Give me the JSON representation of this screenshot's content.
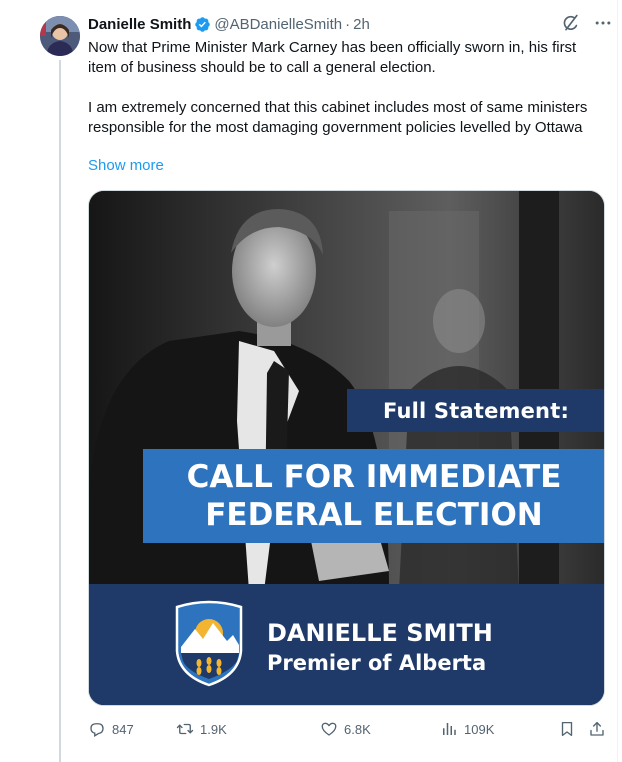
{
  "tweet": {
    "display_name": "Danielle Smith",
    "handle": "@ABDanielleSmith",
    "separator": "·",
    "time": "2h",
    "text_para1": "Now that Prime Minister Mark Carney has been officially sworn in, his first item of business should be to call a general election.",
    "text_para2": "I am extremely concerned that this cabinet includes most of same ministers responsible for the most damaging government policies levelled by Ottawa",
    "show_more": "Show more"
  },
  "media": {
    "statement_label": "Full Statement:",
    "headline_line1": "CALL FOR IMMEDIATE",
    "headline_line2": "FEDERAL ELECTION",
    "name": "DANIELLE SMITH",
    "title": "Premier of Alberta"
  },
  "actions": {
    "replies": "847",
    "reposts": "1.9K",
    "likes": "6.8K",
    "views": "109K"
  },
  "icons": {
    "verified": "verified-badge-icon",
    "grok": "grok-icon",
    "more": "more-icon",
    "reply": "reply-icon",
    "repost": "repost-icon",
    "like": "heart-icon",
    "views": "views-icon",
    "bookmark": "bookmark-icon",
    "share": "share-icon"
  },
  "colors": {
    "link": "#1d9bf0",
    "verified": "#1d9bf0",
    "banner_navy": "#1f3a68",
    "banner_blue": "#2e73bd"
  }
}
